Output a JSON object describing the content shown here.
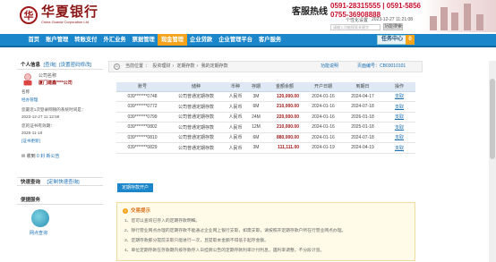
{
  "brand": {
    "name_cn": "华夏银行",
    "name_en": "China Guaxia Corporation Ltd"
  },
  "hotline": {
    "title": "客服热线",
    "numbers": [
      "0591-28315555 | 0591-5856288",
      "0755-36908888"
    ]
  },
  "header": {
    "links": [
      "个性化设置"
    ],
    "time": "2023-12-27 11:21:08",
    "search_placeholder": "请输入功能搜索关键字",
    "search_button": "功能搜索"
  },
  "nav": {
    "items": [
      "首页",
      "账户管理",
      "转账支付",
      "外汇业务",
      "票据管理",
      "现金管理",
      "企业贷款",
      "企业管理平台",
      "客户服务"
    ],
    "active_index": 5,
    "task_label": "任务中心",
    "task_count": "0"
  },
  "sidebar": {
    "account_title": "个人信息",
    "account_link": "[查询]",
    "security_link": "[设置密码修改]",
    "company_label": "公司名称",
    "company_name": "厦门建鑫****公司",
    "user_label": "名称",
    "user_name": "经办管理",
    "last_login_label": "您最近1次登录网银的系统时间是：",
    "last_login_time": "2023-12-27 11:12:59",
    "cert_label": "您的证书有效期：",
    "cert_date": "2026-11-18",
    "cert_link": "[证书更新]",
    "message_text": "收到",
    "message_count": "0 封 新公告",
    "quick_title": "快速查询",
    "quick_link": "[定制快速查询]",
    "service_title": "便捷服务",
    "service_item": "网点查询"
  },
  "breadcrumb": {
    "items": [
      "当前位置",
      "投资理财",
      "定期存款",
      "我的定期存款"
    ],
    "func_link": "功能说明",
    "page_label": "页面编号：CB03010101"
  },
  "table": {
    "headers": [
      "账号",
      "储种",
      "币种",
      "存期",
      "金额余额",
      "开户日期",
      "到期日",
      "操作"
    ],
    "rows": [
      [
        "039*******0748",
        "公司普通定期存款",
        "人民币",
        "3M",
        "120,000.00",
        "2024-01-16",
        "2024-04-17",
        "支取"
      ],
      [
        "039*******0772",
        "公司普通定期存款",
        "人民币",
        "6M",
        "210,000.00",
        "2024-01-16",
        "2024-07-18",
        "支取"
      ],
      [
        "039*******0799",
        "公司普通定期存款",
        "人民币",
        "24M",
        "220,000.00",
        "2024-01-16",
        "2026-01-18",
        "支取"
      ],
      [
        "039*******0802",
        "公司普通定期存款",
        "人民币",
        "12M",
        "210,000.00",
        "2024-01-16",
        "2025-01-18",
        "支取"
      ],
      [
        "039*******0810",
        "公司普通定期存款",
        "人民币",
        "6M",
        "880,000.00",
        "2024-01-16",
        "2024-07-18",
        "支取"
      ],
      [
        "039*******0829",
        "公司普通定期存款",
        "人民币",
        "3M",
        "111,111.00",
        "2024-01-19",
        "2024-04-19",
        "支取"
      ]
    ]
  },
  "open_button": "定期存款开户",
  "tips": {
    "title": "交易提示",
    "items": [
      "1、您可以查询已存入的定期存款明细。",
      "2、除行营业网点办理的定期存款不能通过企业网上银行支取，如需支取，请按照开定期存款户所在行营业网点办理。",
      "3、定期存款部分提前支取只能进行一次，且提取本金额不得低于起存金额。",
      "4、单位定期存款在存款期内按存款存入日挂牌公告的定期存款利率计付利息，遇利率调整，不分段计息。"
    ]
  },
  "colors": {
    "nav": "#1b86c9",
    "active": "#f4a31b",
    "brand": "#8a1414",
    "amount": "#a01a1a"
  }
}
